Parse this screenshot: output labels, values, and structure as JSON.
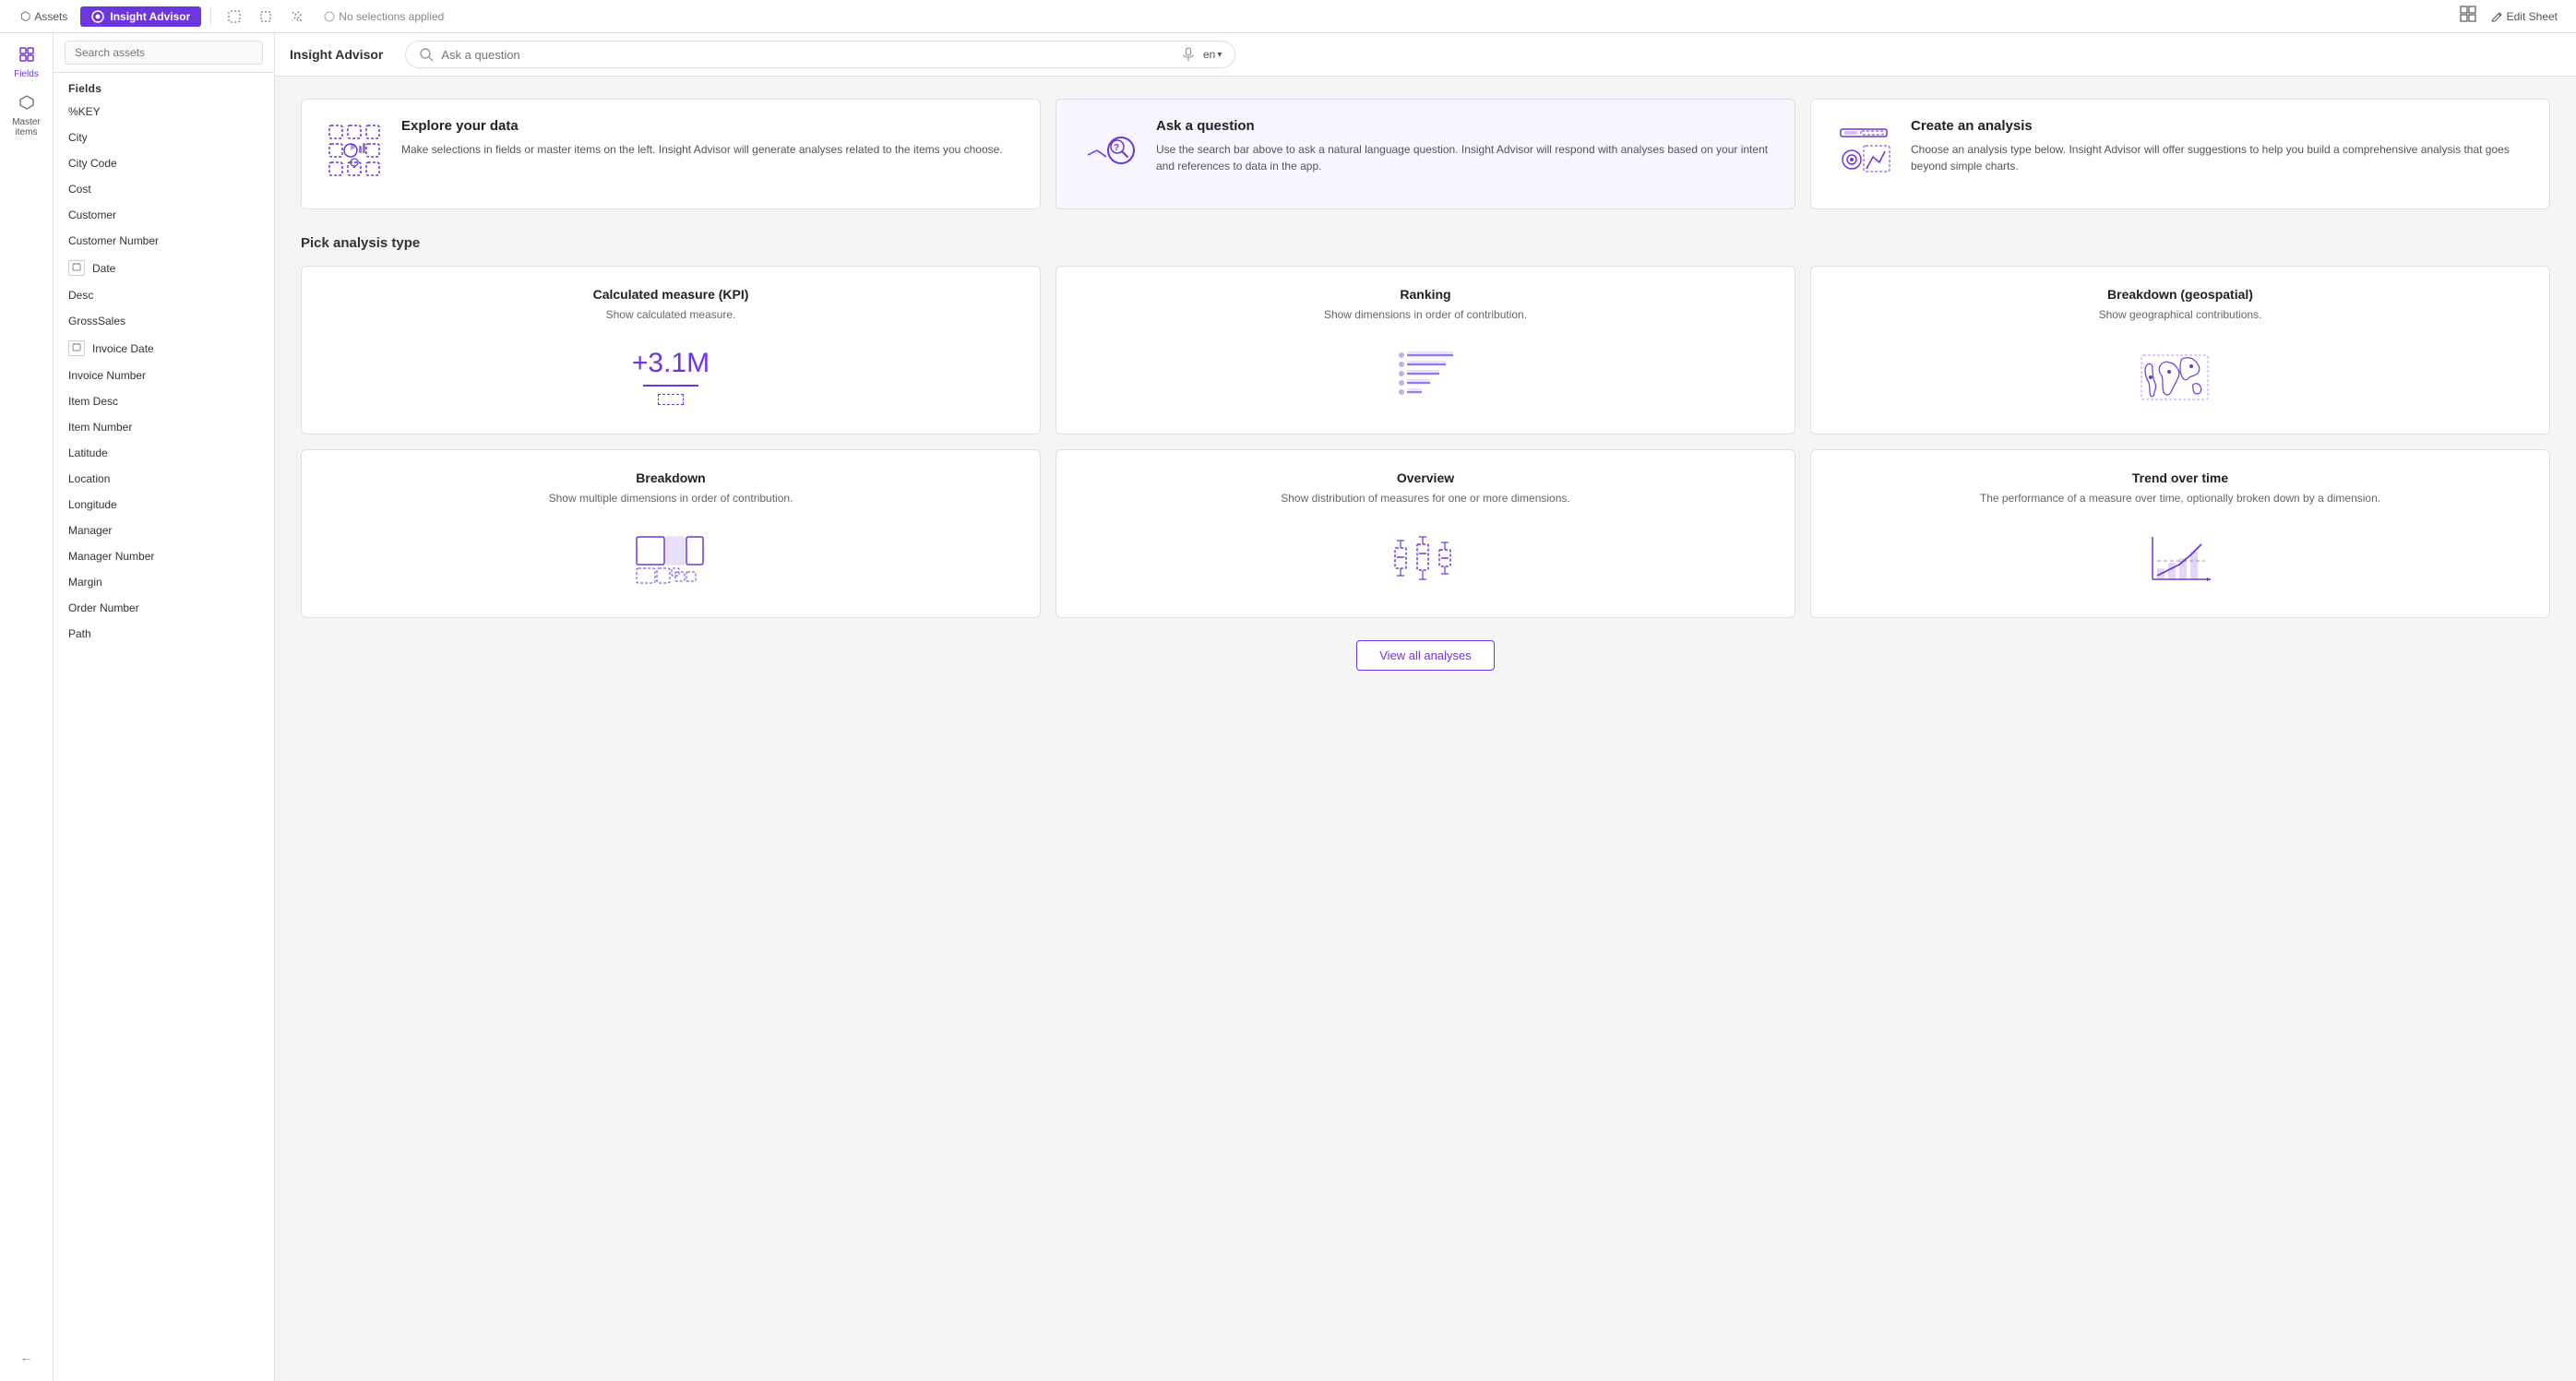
{
  "topNav": {
    "assets_label": "Assets",
    "insight_label": "Insight Advisor",
    "lasso_tooltip": "Lasso select",
    "region_tooltip": "Region select",
    "paint_tooltip": "Paint select",
    "selection_text": "No selections applied",
    "edit_sheet_label": "Edit Sheet"
  },
  "sidebar": {
    "items": [
      {
        "id": "fields",
        "label": "Fields",
        "icon": "≡"
      },
      {
        "id": "master-items",
        "label": "Master items",
        "icon": "◇"
      }
    ],
    "collapse_icon": "←"
  },
  "panel": {
    "search_placeholder": "Search assets",
    "fields_label": "Fields",
    "fields": [
      {
        "name": "%KEY",
        "has_icon": false
      },
      {
        "name": "City",
        "has_icon": false
      },
      {
        "name": "City Code",
        "has_icon": false
      },
      {
        "name": "Cost",
        "has_icon": false
      },
      {
        "name": "Customer",
        "has_icon": false
      },
      {
        "name": "Customer Number",
        "has_icon": false
      },
      {
        "name": "Date",
        "has_icon": true,
        "icon_label": "📅"
      },
      {
        "name": "Desc",
        "has_icon": false
      },
      {
        "name": "GrossSales",
        "has_icon": false
      },
      {
        "name": "Invoice Date",
        "has_icon": true,
        "icon_label": "📅"
      },
      {
        "name": "Invoice Number",
        "has_icon": false
      },
      {
        "name": "Item Desc",
        "has_icon": false
      },
      {
        "name": "Item Number",
        "has_icon": false
      },
      {
        "name": "Latitude",
        "has_icon": false
      },
      {
        "name": "Location",
        "has_icon": false
      },
      {
        "name": "Longitude",
        "has_icon": false
      },
      {
        "name": "Manager",
        "has_icon": false
      },
      {
        "name": "Manager Number",
        "has_icon": false
      },
      {
        "name": "Margin",
        "has_icon": false
      },
      {
        "name": "Order Number",
        "has_icon": false
      },
      {
        "name": "Path",
        "has_icon": false
      }
    ]
  },
  "header": {
    "title": "Insight Advisor",
    "search_placeholder": "Ask a question",
    "language": "en"
  },
  "infoCards": [
    {
      "id": "explore",
      "title": "Explore your data",
      "description": "Make selections in fields or master items on the left. Insight Advisor will generate analyses related to the items you choose."
    },
    {
      "id": "ask",
      "title": "Ask a question",
      "description": "Use the search bar above to ask a natural language question. Insight Advisor will respond with analyses based on your intent and references to data in the app."
    },
    {
      "id": "create",
      "title": "Create an analysis",
      "description": "Choose an analysis type below. Insight Advisor will offer suggestions to help you build a comprehensive analysis that goes beyond simple charts."
    }
  ],
  "analysisSection": {
    "title": "Pick analysis type",
    "types": [
      {
        "id": "kpi",
        "title": "Calculated measure (KPI)",
        "description": "Show calculated measure.",
        "visual_type": "kpi"
      },
      {
        "id": "ranking",
        "title": "Ranking",
        "description": "Show dimensions in order of contribution.",
        "visual_type": "ranking"
      },
      {
        "id": "breakdown-geo",
        "title": "Breakdown (geospatial)",
        "description": "Show geographical contributions.",
        "visual_type": "geo"
      },
      {
        "id": "breakdown",
        "title": "Breakdown",
        "description": "Show multiple dimensions in order of contribution.",
        "visual_type": "breakdown"
      },
      {
        "id": "overview",
        "title": "Overview",
        "description": "Show distribution of measures for one or more dimensions.",
        "visual_type": "overview"
      },
      {
        "id": "trend",
        "title": "Trend over time",
        "description": "The performance of a measure over time, optionally broken down by a dimension.",
        "visual_type": "trend"
      }
    ],
    "view_all_label": "View all analyses"
  }
}
